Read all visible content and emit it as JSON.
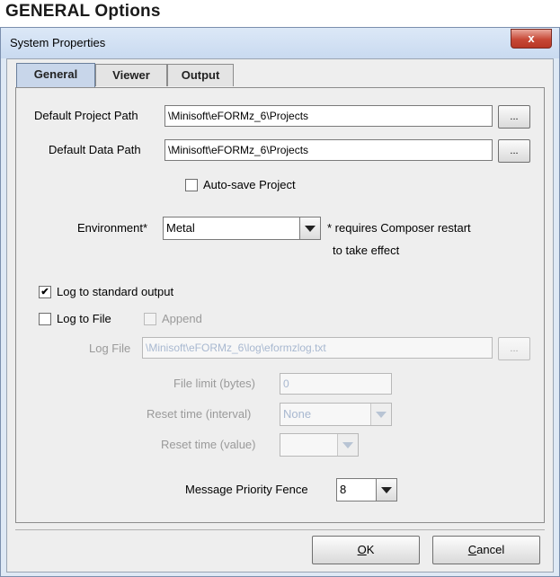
{
  "page": {
    "heading": "GENERAL Options"
  },
  "window": {
    "title": "System Properties",
    "close_glyph": "x"
  },
  "tabs": [
    {
      "label": "General",
      "active": true
    },
    {
      "label": "Viewer",
      "active": false
    },
    {
      "label": "Output",
      "active": false
    }
  ],
  "general": {
    "project_path_label": "Default Project Path",
    "project_path_value": "\\Minisoft\\eFORMz_6\\Projects",
    "data_path_label": "Default Data Path",
    "data_path_value": "\\Minisoft\\eFORMz_6\\Projects",
    "browse_label": "...",
    "autosave_label": "Auto-save Project",
    "autosave_checked": false,
    "environment_label": "Environment*",
    "environment_value": "Metal",
    "environment_note_line1": "* requires Composer restart",
    "environment_note_line2": "to take effect",
    "log_stdout_label": "Log to standard output",
    "log_stdout_checked": true,
    "log_file_label": "Log to File",
    "log_file_checked": false,
    "append_label": "Append",
    "append_checked": false,
    "log_file_field_label": "Log File",
    "log_file_value": "\\Minisoft\\eFORMz_6\\log\\eformzlog.txt",
    "file_limit_label": "File limit (bytes)",
    "file_limit_value": "0",
    "reset_interval_label": "Reset time (interval)",
    "reset_interval_value": "None",
    "reset_value_label": "Reset time (value)",
    "reset_value_value": "",
    "priority_label": "Message Priority Fence",
    "priority_value": "8"
  },
  "dialog_buttons": {
    "ok_mnemonic": "O",
    "ok_rest": "K",
    "cancel_mnemonic": "C",
    "cancel_rest": "ancel"
  },
  "colors": {
    "window_frame": "#dfe9f5",
    "close_button": "#c74836",
    "active_tab": "#c8d6ea"
  },
  "icons": [
    "close-icon",
    "check-icon",
    "dropdown-arrow-icon"
  ]
}
